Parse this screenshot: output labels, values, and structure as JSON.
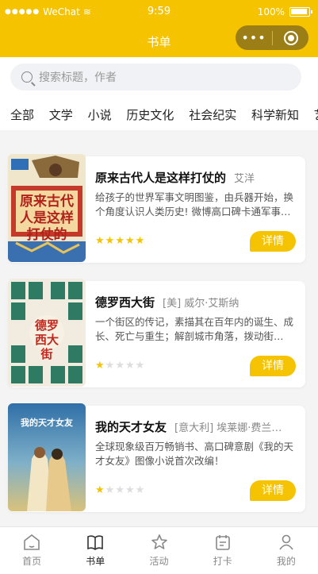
{
  "status": {
    "carrier": "WeChat",
    "time": "9:59",
    "battery": "100%"
  },
  "nav": {
    "title": "书单"
  },
  "search": {
    "placeholder": "搜索标题，作者"
  },
  "categories": [
    "全部",
    "文学",
    "小说",
    "历史文化",
    "社会纪实",
    "科学新知",
    "艺"
  ],
  "books": [
    {
      "title": "原来古代人是这样打仗的",
      "author": "艾洋",
      "desc": "给孩子的世界军事文明图鉴，由兵器开始，换个角度认识人类历史! 微博高口碑卡通军事…",
      "rating": 5,
      "cover_text": "原来古代人是这样打仗的",
      "button": "详情"
    },
    {
      "title": "德罗西大街",
      "author": "[美] 威尔·艾斯纳",
      "desc": "一个街区的传记，素描其在百年内的诞生、成长、死亡与重生；解剖城市角落，拨动街…",
      "rating": 1,
      "cover_text": "德罗西大街",
      "button": "详情"
    },
    {
      "title": "我的天才女友",
      "author": "[意大利] 埃莱娜·费兰…",
      "desc": "全球现象级百万畅销书、高口碑意剧《我的天才女友》图像小说首次改编！",
      "rating": 1,
      "cover_text": "我的天才女友",
      "button": "详情"
    }
  ],
  "tabs": [
    {
      "label": "首页",
      "icon": "home-icon"
    },
    {
      "label": "书单",
      "icon": "book-icon"
    },
    {
      "label": "活动",
      "icon": "star-icon"
    },
    {
      "label": "打卡",
      "icon": "calendar-icon"
    },
    {
      "label": "我的",
      "icon": "user-icon"
    }
  ],
  "colors": {
    "accent": "#f6c300"
  }
}
